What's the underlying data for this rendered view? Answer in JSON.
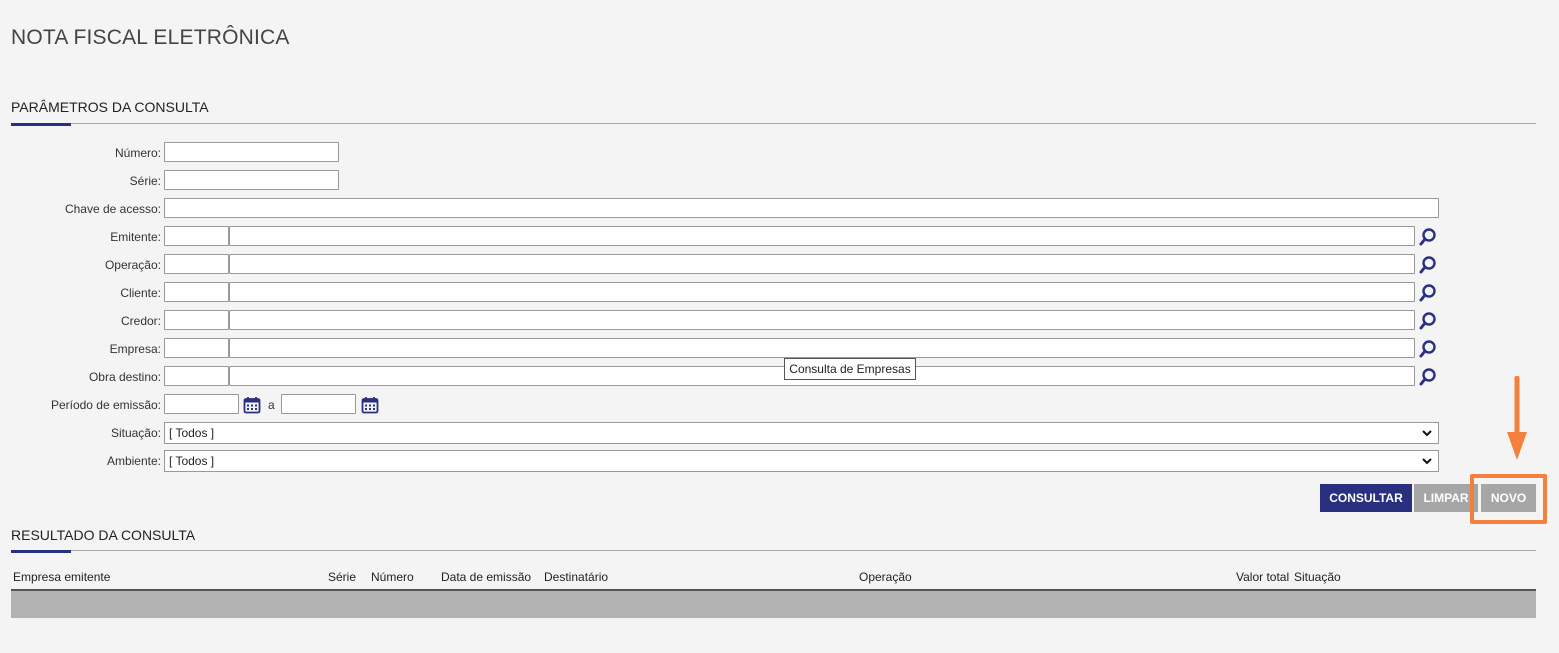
{
  "page": {
    "title": "NOTA FISCAL ELETRÔNICA"
  },
  "params_section": {
    "title": "PARÂMETROS DA CONSULTA"
  },
  "fields": {
    "numero": {
      "label": "Número:",
      "value": ""
    },
    "serie": {
      "label": "Série:",
      "value": ""
    },
    "chave": {
      "label": "Chave de acesso:",
      "value": ""
    },
    "emitente": {
      "label": "Emitente:",
      "code": "",
      "name": ""
    },
    "operacao": {
      "label": "Operação:",
      "code": "",
      "name": ""
    },
    "cliente": {
      "label": "Cliente:",
      "code": "",
      "name": ""
    },
    "credor": {
      "label": "Credor:",
      "code": "",
      "name": ""
    },
    "empresa": {
      "label": "Empresa:",
      "code": "",
      "name": ""
    },
    "obra": {
      "label": "Obra destino:",
      "code": "",
      "name": ""
    },
    "periodo": {
      "label": "Período de emissão:",
      "from": "",
      "separator": "a",
      "to": ""
    },
    "situacao": {
      "label": "Situação:",
      "selected": "[ Todos ]"
    },
    "ambiente": {
      "label": "Ambiente:",
      "selected": "[ Todos ]"
    }
  },
  "tooltip": {
    "text": "Consulta de Empresas"
  },
  "buttons": {
    "consultar": "CONSULTAR",
    "limpar": "LIMPAR",
    "novo": "NOVO"
  },
  "colors": {
    "primary": "#2a3080",
    "disabled": "#a6a6a6",
    "highlight": "#f5803e"
  },
  "result_section": {
    "title": "RESULTADO DA CONSULTA"
  },
  "table": {
    "columns": [
      "Empresa emitente",
      "Série",
      "Número",
      "Data de emissão",
      "Destinatário",
      "Operação",
      "Valor total",
      "Situação"
    ],
    "rows": []
  }
}
